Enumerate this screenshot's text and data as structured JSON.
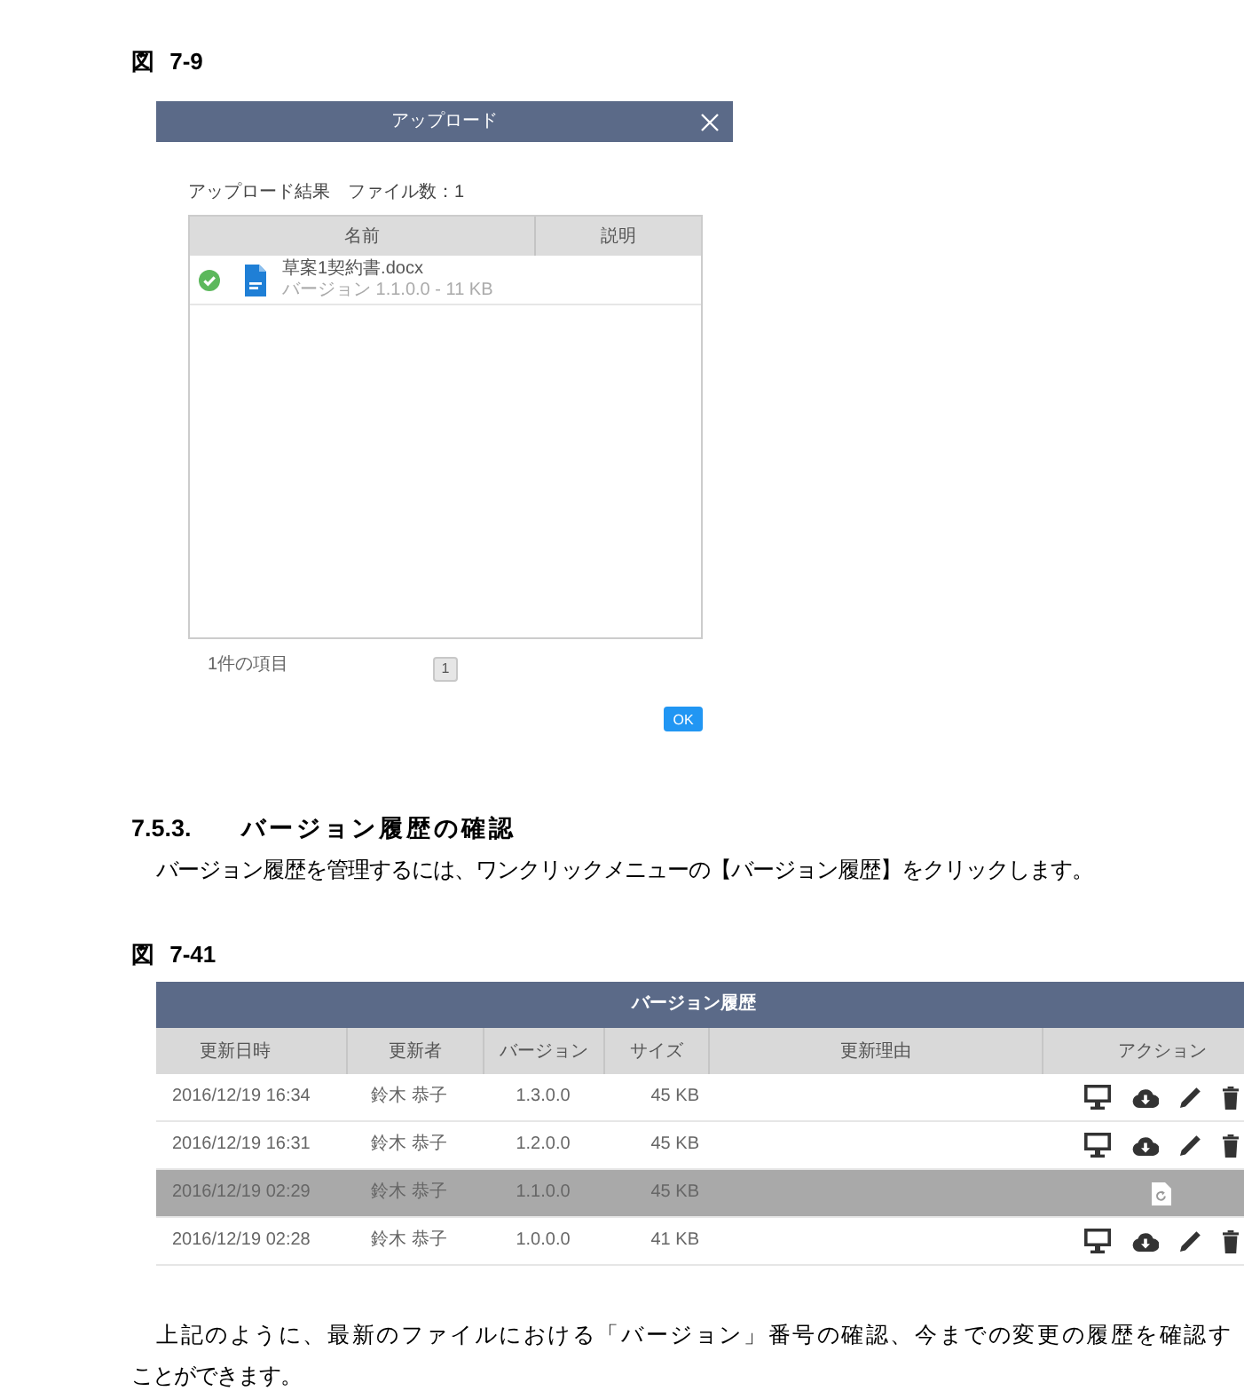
{
  "figure_7_9": {
    "caption": "図 7-9"
  },
  "upload_dialog": {
    "title": "アップロード",
    "summary": "アップロード結果　ファイル数：1",
    "columns": [
      "名前",
      "説明"
    ],
    "files": [
      {
        "name": "草案1契約書.docx",
        "detail": "バージョン 1.1.0.0 - 11 KB"
      }
    ],
    "item_count": "1件の項目",
    "pages": [
      {
        "label": "1",
        "selected": true
      }
    ],
    "ok_button": "OK"
  },
  "section": {
    "number": "7.5.3.",
    "title": "バージョン履歴の確認"
  },
  "intro": "バージョン履歴を管理するには、ワンクリックメニューの【バージョン履歴】をクリックします。",
  "figure_7_41": {
    "caption": "図 7-41"
  },
  "version_history": {
    "title": "バージョン履歴",
    "columns": [
      "更新日時",
      "更新者",
      "バージョン",
      "サイズ",
      "更新理由",
      "アクション"
    ],
    "rows": [
      {
        "updated": "2016/12/19 16:34",
        "author": "鈴木 恭子",
        "version": "1.3.0.0",
        "size": "45 KB",
        "kind": "standard",
        "selected": false
      },
      {
        "updated": "2016/12/19 16:31",
        "author": "鈴木 恭子",
        "version": "1.2.0.0",
        "size": "45 KB",
        "kind": "standard",
        "selected": false
      },
      {
        "updated": "2016/12/19 02:29",
        "author": "鈴木 恭子",
        "version": "1.1.0.0",
        "size": "45 KB",
        "kind": "restore",
        "selected": true
      },
      {
        "updated": "2016/12/19 02:28",
        "author": "鈴木 恭子",
        "version": "1.0.0.0",
        "size": "41 KB",
        "kind": "standard",
        "selected": false
      }
    ]
  },
  "closing": [
    "上記のように、最新のファイルにおける「バージョン」番号の確認、今までの変更の履歴を確認す",
    "ことができます。"
  ]
}
